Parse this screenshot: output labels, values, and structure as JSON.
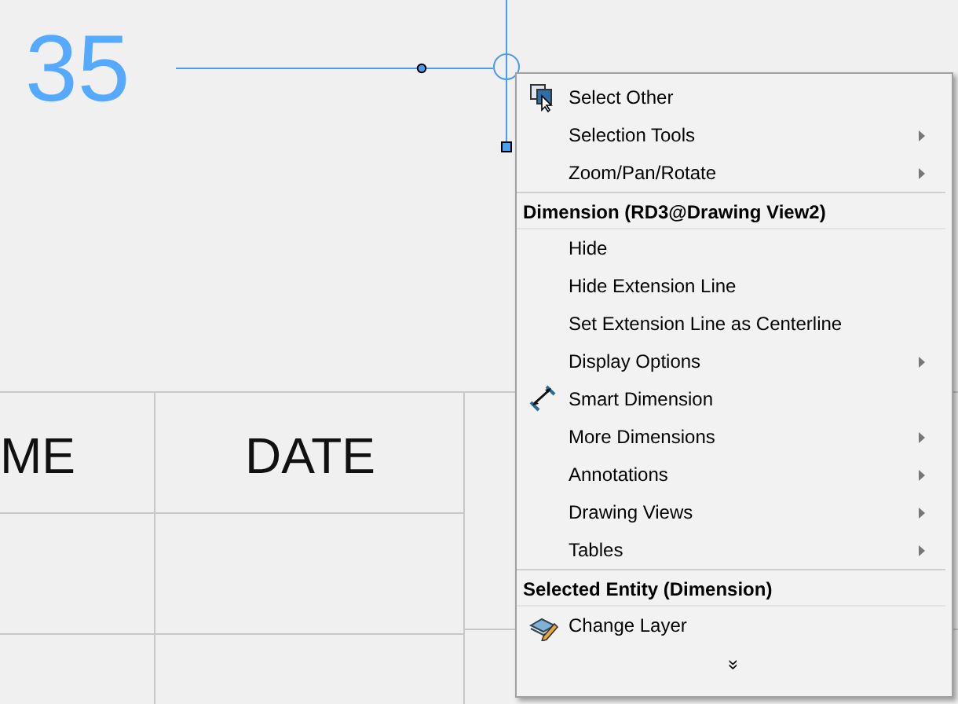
{
  "drawing": {
    "dimension": {
      "value": "35"
    },
    "title_block": {
      "cells": [
        "ME",
        "DATE"
      ]
    }
  },
  "context_menu": {
    "items": [
      {
        "kind": "item",
        "label": "Select Other",
        "submenu": false
      },
      {
        "kind": "item",
        "label": "Selection Tools",
        "submenu": true
      },
      {
        "kind": "item",
        "label": "Zoom/Pan/Rotate",
        "submenu": true
      },
      {
        "kind": "header",
        "label": "Dimension (RD3@Drawing View2)"
      },
      {
        "kind": "item",
        "label": "Hide",
        "submenu": false
      },
      {
        "kind": "item",
        "label": "Hide Extension Line",
        "submenu": false
      },
      {
        "kind": "item",
        "label": "Set Extension Line as Centerline",
        "submenu": false
      },
      {
        "kind": "item",
        "label": "Display Options",
        "submenu": true
      },
      {
        "kind": "item",
        "label": "Smart Dimension",
        "submenu": false
      },
      {
        "kind": "item",
        "label": "More Dimensions",
        "submenu": true
      },
      {
        "kind": "item",
        "label": "Annotations",
        "submenu": true
      },
      {
        "kind": "item",
        "label": "Drawing Views",
        "submenu": true
      },
      {
        "kind": "item",
        "label": "Tables",
        "submenu": true
      },
      {
        "kind": "header",
        "label": "Selected Entity (Dimension)"
      },
      {
        "kind": "item",
        "label": "Change Layer",
        "submenu": false
      },
      {
        "kind": "more",
        "label": "»"
      }
    ]
  }
}
